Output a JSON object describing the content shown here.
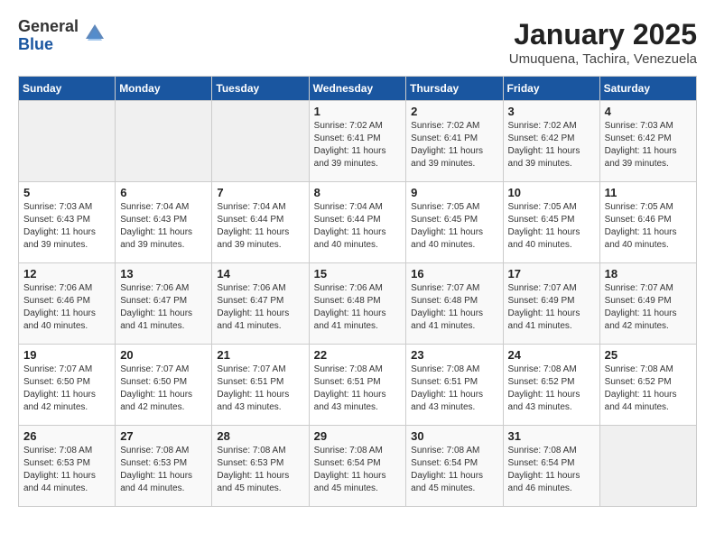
{
  "logo": {
    "general": "General",
    "blue": "Blue"
  },
  "title": "January 2025",
  "location": "Umuquena, Tachira, Venezuela",
  "weekdays": [
    "Sunday",
    "Monday",
    "Tuesday",
    "Wednesday",
    "Thursday",
    "Friday",
    "Saturday"
  ],
  "weeks": [
    [
      {
        "day": "",
        "info": ""
      },
      {
        "day": "",
        "info": ""
      },
      {
        "day": "",
        "info": ""
      },
      {
        "day": "1",
        "info": "Sunrise: 7:02 AM\nSunset: 6:41 PM\nDaylight: 11 hours\nand 39 minutes."
      },
      {
        "day": "2",
        "info": "Sunrise: 7:02 AM\nSunset: 6:41 PM\nDaylight: 11 hours\nand 39 minutes."
      },
      {
        "day": "3",
        "info": "Sunrise: 7:02 AM\nSunset: 6:42 PM\nDaylight: 11 hours\nand 39 minutes."
      },
      {
        "day": "4",
        "info": "Sunrise: 7:03 AM\nSunset: 6:42 PM\nDaylight: 11 hours\nand 39 minutes."
      }
    ],
    [
      {
        "day": "5",
        "info": "Sunrise: 7:03 AM\nSunset: 6:43 PM\nDaylight: 11 hours\nand 39 minutes."
      },
      {
        "day": "6",
        "info": "Sunrise: 7:04 AM\nSunset: 6:43 PM\nDaylight: 11 hours\nand 39 minutes."
      },
      {
        "day": "7",
        "info": "Sunrise: 7:04 AM\nSunset: 6:44 PM\nDaylight: 11 hours\nand 39 minutes."
      },
      {
        "day": "8",
        "info": "Sunrise: 7:04 AM\nSunset: 6:44 PM\nDaylight: 11 hours\nand 40 minutes."
      },
      {
        "day": "9",
        "info": "Sunrise: 7:05 AM\nSunset: 6:45 PM\nDaylight: 11 hours\nand 40 minutes."
      },
      {
        "day": "10",
        "info": "Sunrise: 7:05 AM\nSunset: 6:45 PM\nDaylight: 11 hours\nand 40 minutes."
      },
      {
        "day": "11",
        "info": "Sunrise: 7:05 AM\nSunset: 6:46 PM\nDaylight: 11 hours\nand 40 minutes."
      }
    ],
    [
      {
        "day": "12",
        "info": "Sunrise: 7:06 AM\nSunset: 6:46 PM\nDaylight: 11 hours\nand 40 minutes."
      },
      {
        "day": "13",
        "info": "Sunrise: 7:06 AM\nSunset: 6:47 PM\nDaylight: 11 hours\nand 41 minutes."
      },
      {
        "day": "14",
        "info": "Sunrise: 7:06 AM\nSunset: 6:47 PM\nDaylight: 11 hours\nand 41 minutes."
      },
      {
        "day": "15",
        "info": "Sunrise: 7:06 AM\nSunset: 6:48 PM\nDaylight: 11 hours\nand 41 minutes."
      },
      {
        "day": "16",
        "info": "Sunrise: 7:07 AM\nSunset: 6:48 PM\nDaylight: 11 hours\nand 41 minutes."
      },
      {
        "day": "17",
        "info": "Sunrise: 7:07 AM\nSunset: 6:49 PM\nDaylight: 11 hours\nand 41 minutes."
      },
      {
        "day": "18",
        "info": "Sunrise: 7:07 AM\nSunset: 6:49 PM\nDaylight: 11 hours\nand 42 minutes."
      }
    ],
    [
      {
        "day": "19",
        "info": "Sunrise: 7:07 AM\nSunset: 6:50 PM\nDaylight: 11 hours\nand 42 minutes."
      },
      {
        "day": "20",
        "info": "Sunrise: 7:07 AM\nSunset: 6:50 PM\nDaylight: 11 hours\nand 42 minutes."
      },
      {
        "day": "21",
        "info": "Sunrise: 7:07 AM\nSunset: 6:51 PM\nDaylight: 11 hours\nand 43 minutes."
      },
      {
        "day": "22",
        "info": "Sunrise: 7:08 AM\nSunset: 6:51 PM\nDaylight: 11 hours\nand 43 minutes."
      },
      {
        "day": "23",
        "info": "Sunrise: 7:08 AM\nSunset: 6:51 PM\nDaylight: 11 hours\nand 43 minutes."
      },
      {
        "day": "24",
        "info": "Sunrise: 7:08 AM\nSunset: 6:52 PM\nDaylight: 11 hours\nand 43 minutes."
      },
      {
        "day": "25",
        "info": "Sunrise: 7:08 AM\nSunset: 6:52 PM\nDaylight: 11 hours\nand 44 minutes."
      }
    ],
    [
      {
        "day": "26",
        "info": "Sunrise: 7:08 AM\nSunset: 6:53 PM\nDaylight: 11 hours\nand 44 minutes."
      },
      {
        "day": "27",
        "info": "Sunrise: 7:08 AM\nSunset: 6:53 PM\nDaylight: 11 hours\nand 44 minutes."
      },
      {
        "day": "28",
        "info": "Sunrise: 7:08 AM\nSunset: 6:53 PM\nDaylight: 11 hours\nand 45 minutes."
      },
      {
        "day": "29",
        "info": "Sunrise: 7:08 AM\nSunset: 6:54 PM\nDaylight: 11 hours\nand 45 minutes."
      },
      {
        "day": "30",
        "info": "Sunrise: 7:08 AM\nSunset: 6:54 PM\nDaylight: 11 hours\nand 45 minutes."
      },
      {
        "day": "31",
        "info": "Sunrise: 7:08 AM\nSunset: 6:54 PM\nDaylight: 11 hours\nand 46 minutes."
      },
      {
        "day": "",
        "info": ""
      }
    ]
  ]
}
